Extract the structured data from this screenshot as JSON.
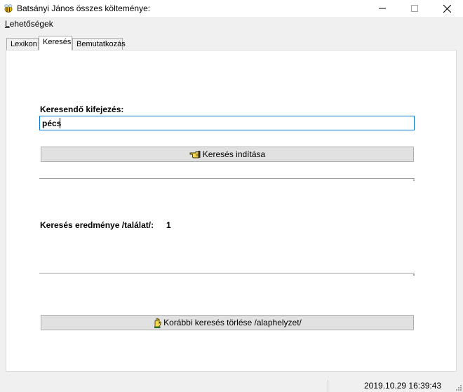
{
  "window": {
    "title": "Batsányi János összes költeménye:"
  },
  "menu": {
    "items": [
      {
        "first_letter": "L",
        "rest": "ehetőségek"
      }
    ]
  },
  "tabs": [
    {
      "label": "Lexikon",
      "active": false
    },
    {
      "label": "Keresés",
      "active": true
    },
    {
      "label": "Bemutatkozás",
      "active": false
    }
  ],
  "search": {
    "label": "Keresendő kifejezés:",
    "value": "pécs",
    "button_label": "Keresés indítása",
    "button_icon": "pointing-hand-icon"
  },
  "result": {
    "label": "Keresés eredménye /találat/:",
    "count": "1"
  },
  "clear": {
    "button_label": "Korábbi keresés törlése /alaphelyzet/",
    "button_icon": "raised-hand-icon"
  },
  "status": {
    "datetime": "2019.10.29 16:39:43"
  },
  "colors": {
    "focus_border": "#0078d7",
    "button_bg": "#e1e1e1",
    "window_bg": "#f0f0f0"
  }
}
